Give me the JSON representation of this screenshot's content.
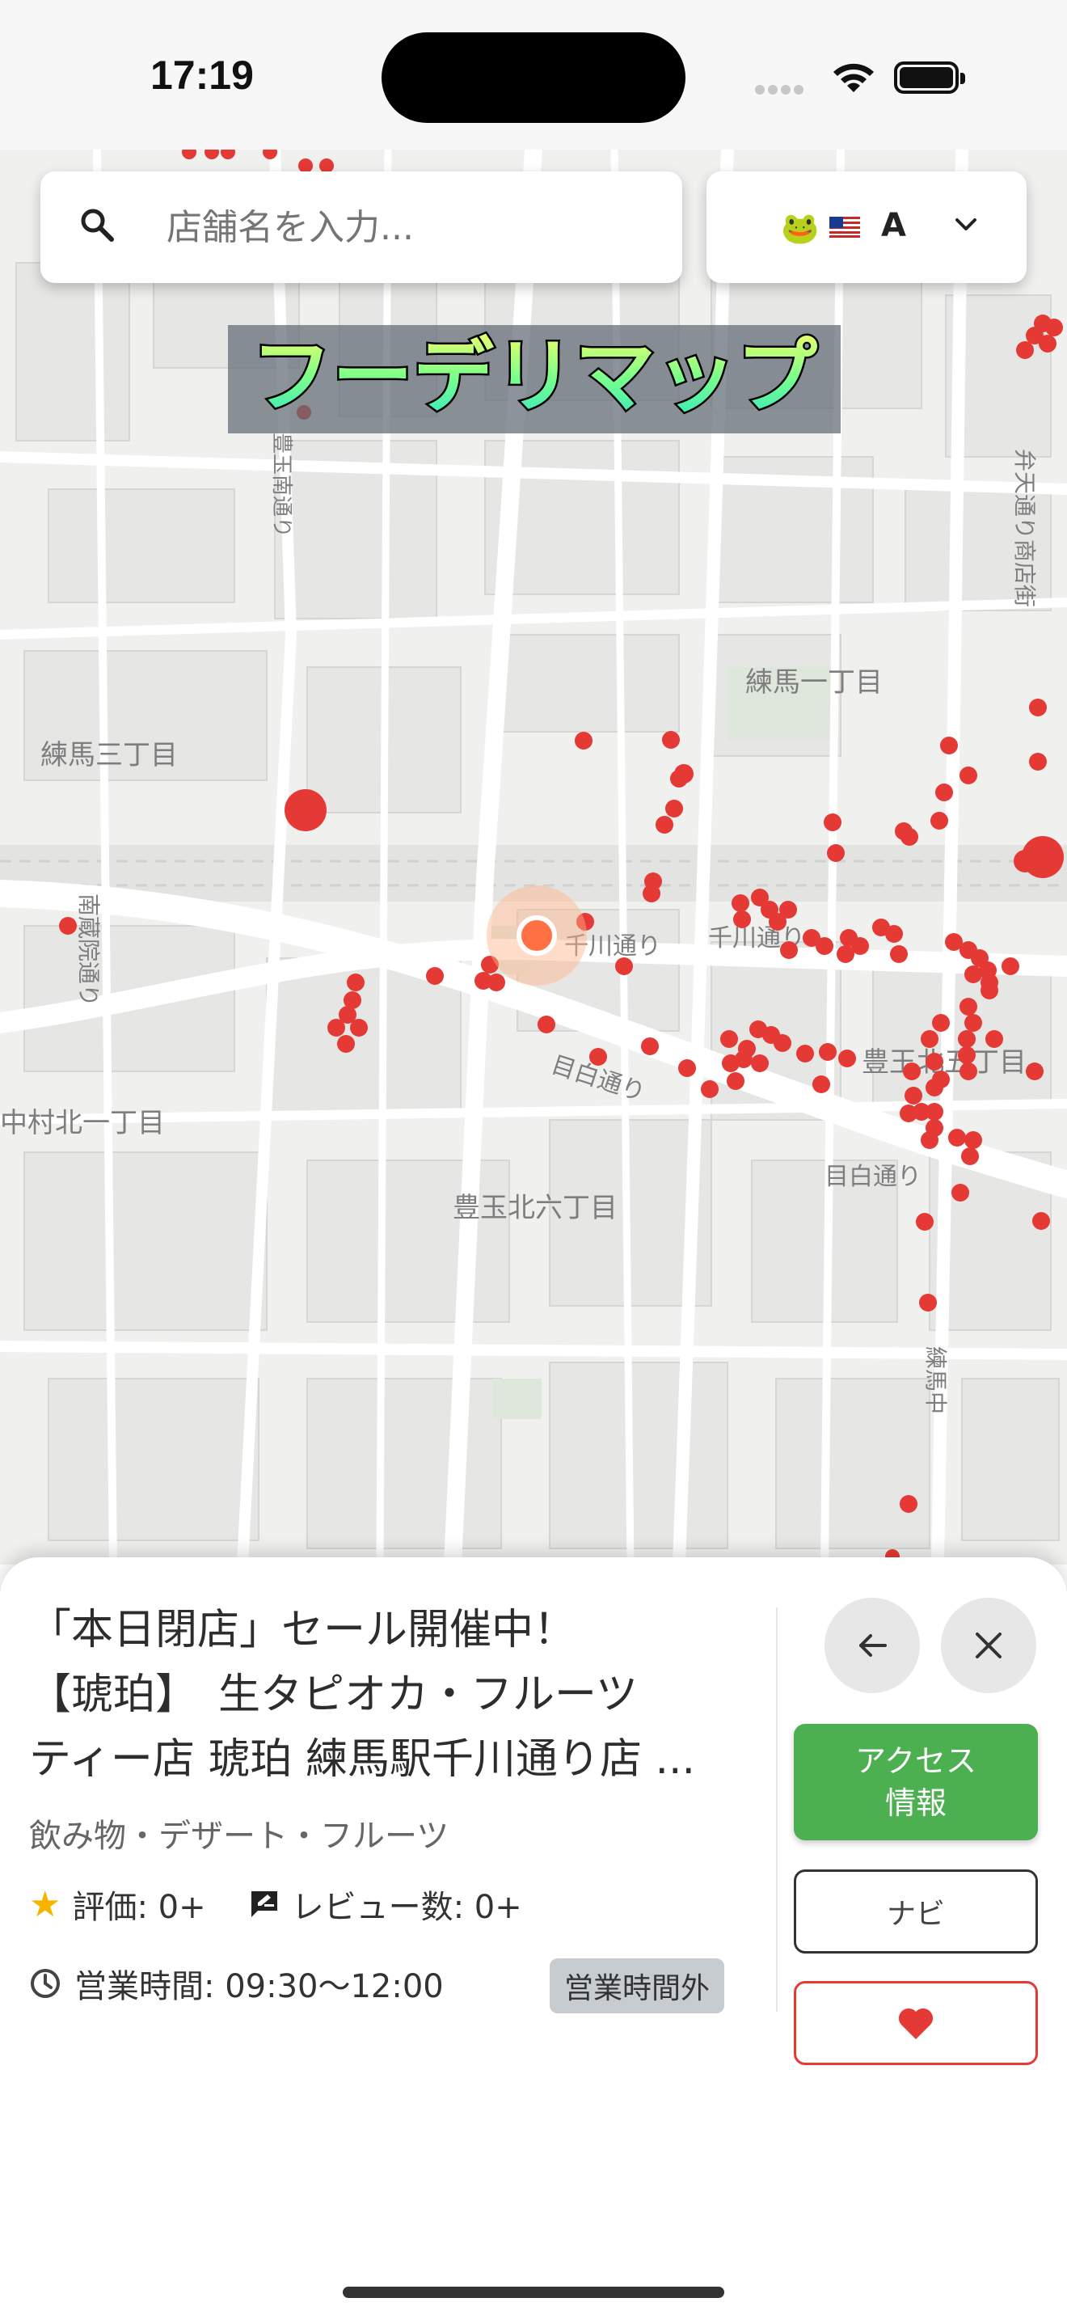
{
  "status_bar": {
    "time": "17:19"
  },
  "search": {
    "placeholder": "店舗名を入力..."
  },
  "language": {
    "selected": "A",
    "icons": [
      "frog-icon",
      "us-flag-icon"
    ]
  },
  "app_title": "フーデリマップ",
  "map": {
    "labels": [
      "練馬一丁目",
      "練馬三丁目",
      "豊玉北五丁目",
      "中村北一丁目",
      "豊玉北六丁目",
      "千川通り",
      "千川通り",
      "目白通り",
      "目白通り",
      "弁天通り商店街",
      "南蔵院通り",
      "豊玉南通り",
      "練馬中"
    ],
    "accent_marker_color": "#e53935",
    "current_location_color": "#ff7043"
  },
  "shop": {
    "name_lines": [
      "「本日閉店」セール開催中！",
      "【琥珀】　生タピオカ・フルーツ",
      "ティー店 琥珀 練馬駅千川通り店 ..."
    ],
    "category": "飲み物・デザート・フルーツ",
    "rating_label": "評価: 0+",
    "review_label": "レビュー数: 0+",
    "hours_label": "営業時間: 09:30〜12:00",
    "status_badge": "営業時間外"
  },
  "buttons": {
    "access_line1": "アクセス",
    "access_line2": "情報",
    "navi": "ナビ"
  },
  "colors": {
    "green": "#4caf50",
    "red": "#e53935"
  }
}
